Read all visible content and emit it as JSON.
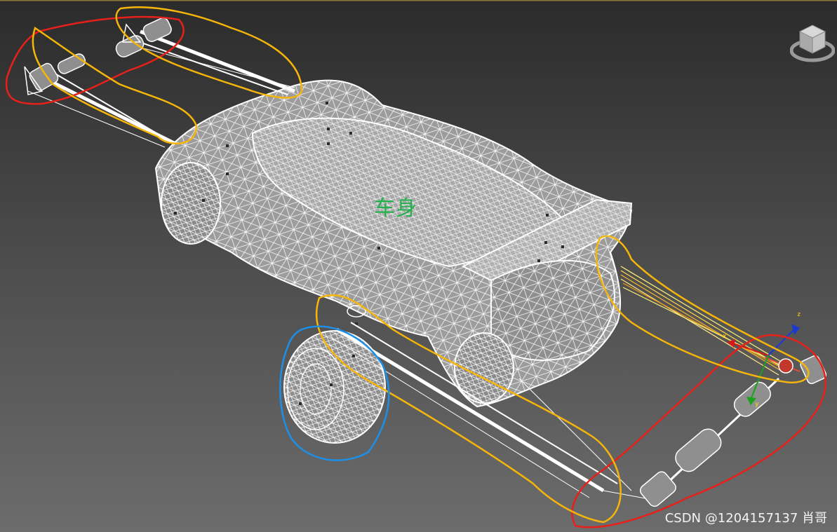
{
  "viewport": {
    "label_body": "车身",
    "watermark": "CSDN @1204157137 肖哥",
    "axis": {
      "x": "x",
      "y": "y",
      "z": "z"
    }
  },
  "colors": {
    "background_top": "#2b2b2b",
    "background_bottom": "#6c6c6c",
    "wireframe": "#ffffff",
    "body_fill": "#9a9a9a",
    "annotation_red": "#e8201a",
    "annotation_orange": "#f5b50a",
    "annotation_blue": "#1e8fe6",
    "label_green": "#22b14c",
    "axis_x": "#d11a1a",
    "axis_y": "#1aa31a",
    "axis_z": "#1a3ad1"
  },
  "icons": [
    "viewcube-icon",
    "gizmo-icon"
  ]
}
